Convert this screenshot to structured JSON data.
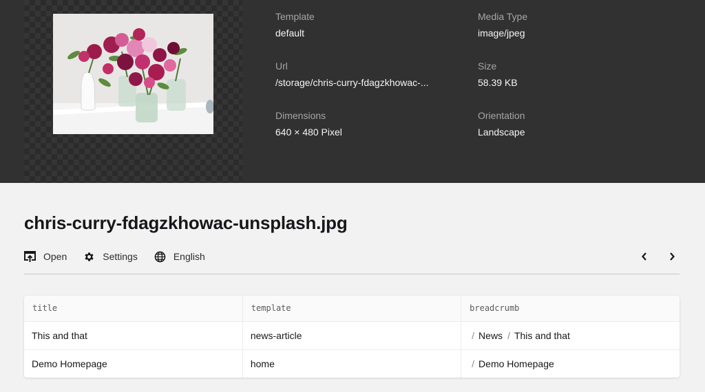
{
  "file": {
    "name": "chris-curry-fdagzkhowac-unsplash.jpg"
  },
  "meta": {
    "template_label": "Template",
    "template_value": "default",
    "media_type_label": "Media Type",
    "media_type_value": "image/jpeg",
    "url_label": "Url",
    "url_value": "/storage/chris-curry-fdagzkhowac-...",
    "size_label": "Size",
    "size_value": "58.39 KB",
    "dimensions_label": "Dimensions",
    "dimensions_value": "640 × 480 Pixel",
    "orientation_label": "Orientation",
    "orientation_value": "Landscape"
  },
  "toolbar": {
    "open_label": "Open",
    "settings_label": "Settings",
    "language_label": "English"
  },
  "table": {
    "headers": [
      "title",
      "template",
      "breadcrumb"
    ],
    "rows": [
      {
        "title": "This and that",
        "template": "news-article",
        "breadcrumb": [
          "News",
          "This and that"
        ]
      },
      {
        "title": "Demo Homepage",
        "template": "home",
        "breadcrumb": [
          "Demo Homepage"
        ]
      }
    ]
  },
  "colors": {
    "header_bg": "#313131",
    "page_bg": "#f2f2f2",
    "title": "#16171a"
  },
  "icons": {
    "open": "open-icon",
    "settings": "gear-icon",
    "language": "globe-icon",
    "prev": "chevron-left-icon",
    "next": "chevron-right-icon"
  }
}
